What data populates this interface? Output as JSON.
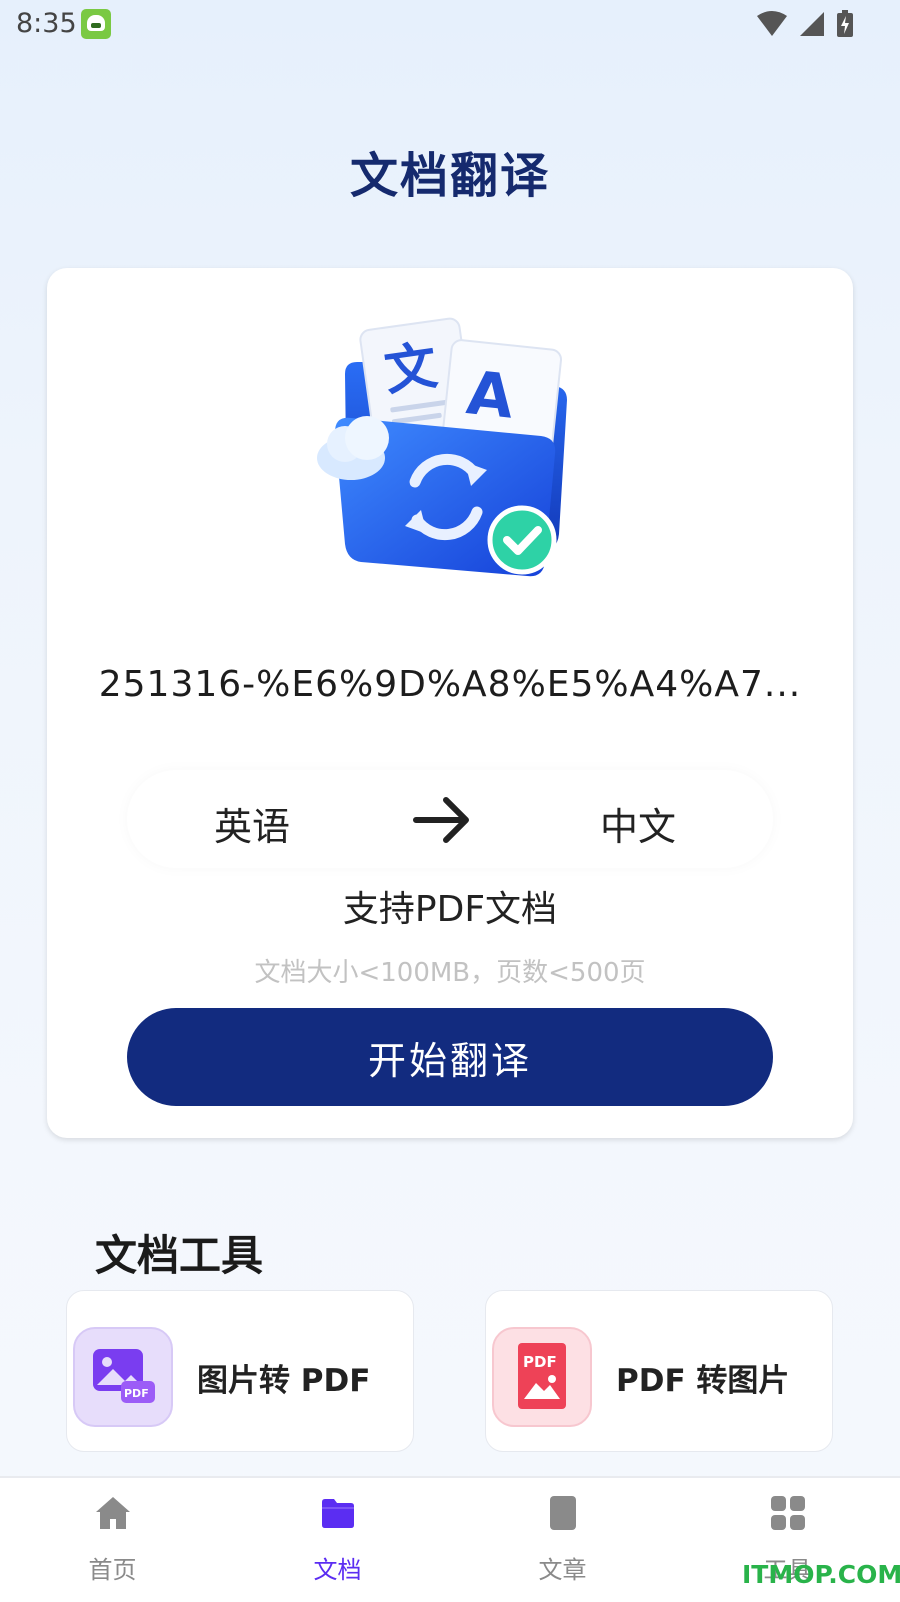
{
  "status_bar": {
    "time": "8:35"
  },
  "header": {
    "title": "文档翻译"
  },
  "translate_card": {
    "file_name": "251316-%E6%9D%A8%E5%A4%A7...",
    "source_language": "英语",
    "target_language": "中文",
    "support_text": "支持PDF文档",
    "limit_text": "文档大小<100MB，页数<500页",
    "start_button_label": "开始翻译",
    "illustration_text_a": "文",
    "illustration_text_b": "A"
  },
  "tools": {
    "title": "文档工具",
    "items": [
      {
        "label": "图片转 PDF",
        "icon": "image-to-pdf-icon",
        "badge": "PDF"
      },
      {
        "label": "PDF 转图片",
        "icon": "pdf-to-image-icon",
        "badge": "PDF"
      }
    ]
  },
  "bottom_nav": {
    "items": [
      {
        "label": "首页",
        "icon": "home-icon"
      },
      {
        "label": "文档",
        "icon": "folder-icon",
        "active": true
      },
      {
        "label": "文章",
        "icon": "article-icon"
      },
      {
        "label": "工具",
        "icon": "grid-icon"
      }
    ]
  },
  "watermark": "ITMOP.COM",
  "colors": {
    "title": "#152a6e",
    "primary_button": "#122b7f",
    "active_nav": "#5b2df2",
    "inactive_nav": "#8a8a8a"
  }
}
